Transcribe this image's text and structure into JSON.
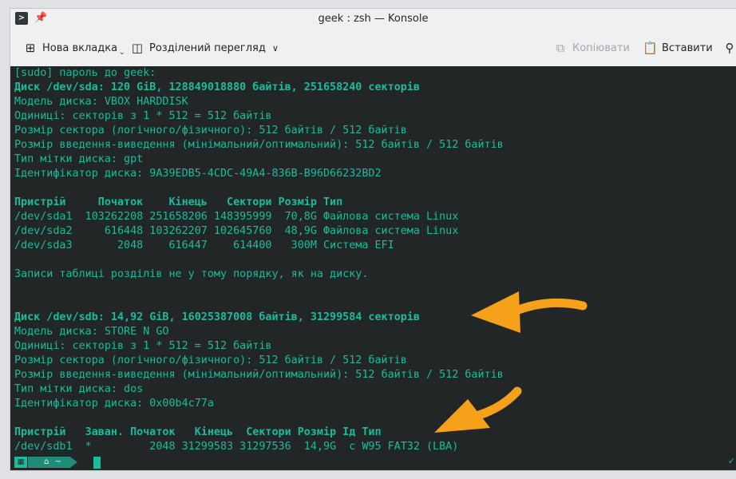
{
  "window": {
    "title": "geek : zsh — Konsole"
  },
  "toolbar": {
    "new_tab": "Нова вкладка",
    "split_view": "Розділений перегляд",
    "copy": "Копіювати",
    "paste": "Вставити"
  },
  "terminal": {
    "lines": [
      "[sudo] пароль до geek:",
      "Диск /dev/sda: 120 GiB, 128849018880 байтів, 251658240 секторів",
      "Модель диска: VBOX HARDDISK",
      "Одиниці: секторів з 1 * 512 = 512 байтів",
      "Розмір сектора (логічного/фізичного): 512 байтів / 512 байтів",
      "Розмір введення-виведення (мінімальний/оптимальний): 512 байтів / 512 байтів",
      "Тип мітки диска: gpt",
      "Ідентифікатор диска: 9A39EDB5-4CDC-49A4-836B-B96D66232BD2",
      "",
      "Пристрій     Початок    Кінець   Сектори Розмір Тип",
      "/dev/sda1  103262208 251658206 148395999  70,8G Файлова система Linux",
      "/dev/sda2     616448 103262207 102645760  48,9G Файлова система Linux",
      "/dev/sda3       2048    616447    614400   300M Система EFI",
      "",
      "Записи таблиці розділів не у тому порядку, як на диску.",
      "",
      "",
      "Диск /dev/sdb: 14,92 GiB, 16025387008 байтів, 31299584 секторів",
      "Модель диска: STORE N GO",
      "Одиниці: секторів з 1 * 512 = 512 байтів",
      "Розмір сектора (логічного/фізичного): 512 байтів / 512 байтів",
      "Розмір введення-виведення (мінімальний/оптимальний): 512 байтів / 512 байтів",
      "Тип мітки диска: dos",
      "Ідентифікатор диска: 0x00b4c77a",
      "",
      "Пристрій   Заван. Початок   Кінець  Сектори Розмір Ід Тип",
      "/dev/sdb1  *         2048 31299583 31297536  14,9G  c W95 FAT32 (LBA)"
    ],
    "bold_lines": [
      1,
      9,
      17,
      25
    ]
  },
  "prompt": {
    "home_label": "~"
  },
  "colors": {
    "terminal_bg": "#232627",
    "terminal_fg": "#1abc9c",
    "annotation_arrow": "#f5a11a"
  }
}
